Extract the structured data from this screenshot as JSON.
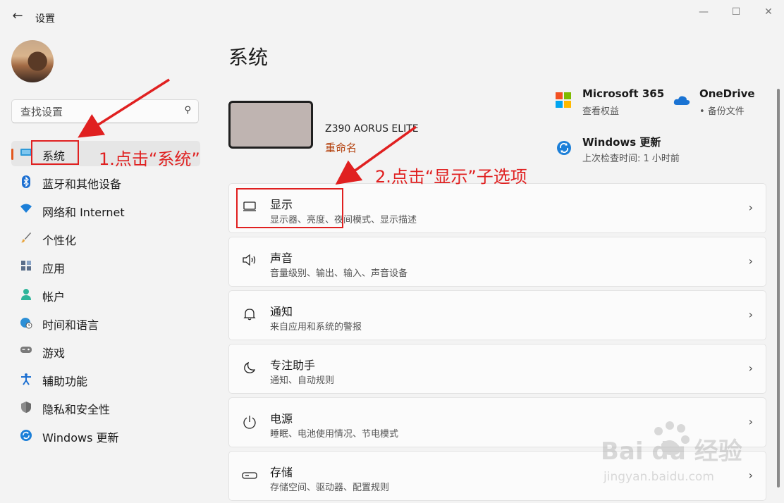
{
  "window": {
    "title": "设置",
    "back_glyph": "←",
    "controls": [
      "—",
      "☐",
      "✕"
    ]
  },
  "search": {
    "placeholder": "查找设置",
    "icon": "search-icon"
  },
  "sidebar": {
    "items": [
      {
        "label": "系统",
        "icon": "monitor-icon",
        "selected": true
      },
      {
        "label": "蓝牙和其他设备",
        "icon": "bluetooth-icon"
      },
      {
        "label": "网络和 Internet",
        "icon": "wifi-icon"
      },
      {
        "label": "个性化",
        "icon": "brush-icon"
      },
      {
        "label": "应用",
        "icon": "apps-icon"
      },
      {
        "label": "帐户",
        "icon": "person-icon"
      },
      {
        "label": "时间和语言",
        "icon": "globe-clock-icon"
      },
      {
        "label": "游戏",
        "icon": "gamepad-icon"
      },
      {
        "label": "辅助功能",
        "icon": "accessibility-icon"
      },
      {
        "label": "隐私和安全性",
        "icon": "shield-icon"
      },
      {
        "label": "Windows 更新",
        "icon": "update-icon"
      }
    ]
  },
  "main": {
    "title": "系统",
    "device": {
      "name": "Z390 AORUS ELITE",
      "rename": "重命名"
    },
    "quick": {
      "ms365": {
        "title": "Microsoft 365",
        "subtitle": "查看权益"
      },
      "onedrive": {
        "title": "OneDrive",
        "subtitle": "• 备份文件"
      },
      "update": {
        "title": "Windows 更新",
        "subtitle": "上次检查时间: 1 小时前"
      }
    },
    "cards": [
      {
        "title": "显示",
        "subtitle": "显示器、亮度、夜间模式、显示描述",
        "icon": "display-icon"
      },
      {
        "title": "声音",
        "subtitle": "音量级别、输出、输入、声音设备",
        "icon": "speaker-icon"
      },
      {
        "title": "通知",
        "subtitle": "来自应用和系统的警报",
        "icon": "bell-icon"
      },
      {
        "title": "专注助手",
        "subtitle": "通知、自动规则",
        "icon": "moon-icon"
      },
      {
        "title": "电源",
        "subtitle": "睡眠、电池使用情况、节电模式",
        "icon": "power-icon"
      },
      {
        "title": "存储",
        "subtitle": "存储空间、驱动器、配置规则",
        "icon": "drive-icon"
      }
    ]
  },
  "annotations": {
    "step1": "1.点击“系统”",
    "step2": "2.点击“显示”子选项",
    "color": "#e02020"
  },
  "watermark": {
    "brand": "Bai du 经验",
    "url": "jingyan.baidu.com"
  },
  "colors": {
    "accent": "#e2571e",
    "rename": "#b4420f",
    "annotation": "#e02020"
  }
}
